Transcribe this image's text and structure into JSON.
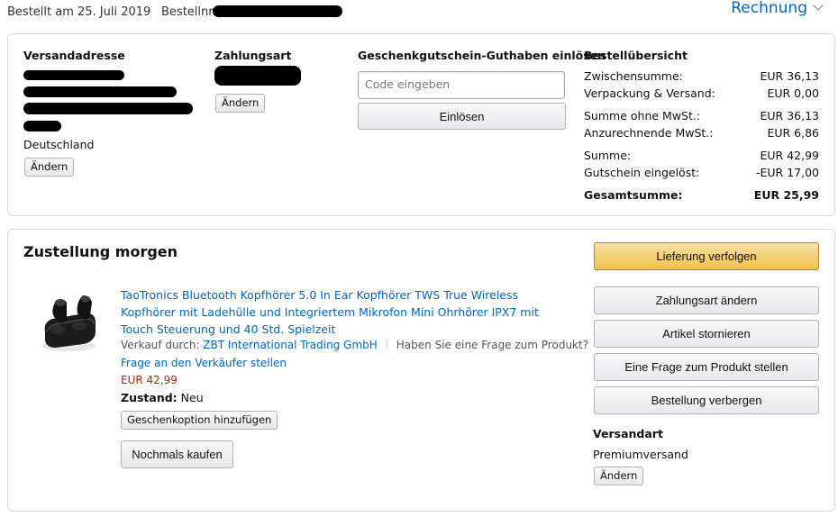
{
  "header": {
    "order_date": "Bestellt am 25. Juli 2019",
    "order_number_label": "Bestellnr.",
    "invoice_link": "Rechnung"
  },
  "shipping_address": {
    "heading": "Versandadresse",
    "country": "Deutschland",
    "change_button": "Ändern"
  },
  "payment": {
    "heading": "Zahlungsart",
    "change_button": "Ändern"
  },
  "gift_card": {
    "heading": "Geschenkgutschein-Guthaben einlösen",
    "input_placeholder": "Code eingeben",
    "redeem_button": "Einlösen"
  },
  "summary": {
    "heading": "Bestellübersicht",
    "rows": [
      {
        "label": "Zwischensumme:",
        "value": "EUR 36,13"
      },
      {
        "label": "Verpackung & Versand:",
        "value": "EUR 0,00"
      },
      {
        "label": "Summe ohne MwSt.:",
        "value": "EUR 36,13"
      },
      {
        "label": "Anzurechnende MwSt.:",
        "value": "EUR 6,86"
      },
      {
        "label": "Summe:",
        "value": "EUR 42,99"
      },
      {
        "label": "Gutschein eingelöst:",
        "value": "-EUR 17,00"
      },
      {
        "label": "Gesamtsumme:",
        "value": "EUR 25,99"
      }
    ]
  },
  "delivery": {
    "title": "Zustellung morgen",
    "product": {
      "title": "TaoTronics Bluetooth Kopfhörer 5.0 In Ear Kopfhörer TWS True Wireless Kopfhörer mit Ladehülle und Integriertem Mikrofon Mini Ohrhörer IPX7 mit Touch Steuerung und 40 Std. Spielzeit",
      "sold_by_label": "Verkauf durch:",
      "seller": "ZBT International Trading GmbH",
      "question_text": "Haben Sie eine Frage zum Produkt?",
      "ask_seller_link": "Frage an den Verkäufer stellen",
      "price": "EUR 42,99",
      "condition_label": "Zustand:",
      "condition_value": "Neu",
      "gift_option_button": "Geschenkoption hinzufügen",
      "buy_again_button": "Nochmals kaufen"
    },
    "actions": {
      "track": "Lieferung verfolgen",
      "change_payment": "Zahlungsart ändern",
      "cancel_items": "Artikel stornieren",
      "ask_question": "Eine Frage zum Produkt stellen",
      "hide_order": "Bestellung verbergen"
    },
    "shipping_method": {
      "heading": "Versandart",
      "value": "Premiumversand",
      "change_button": "Ändern"
    }
  },
  "colors": {
    "link": "#0066c0",
    "price": "#b12704",
    "primary_button": "#f0c14b",
    "redaction": "#000000"
  }
}
